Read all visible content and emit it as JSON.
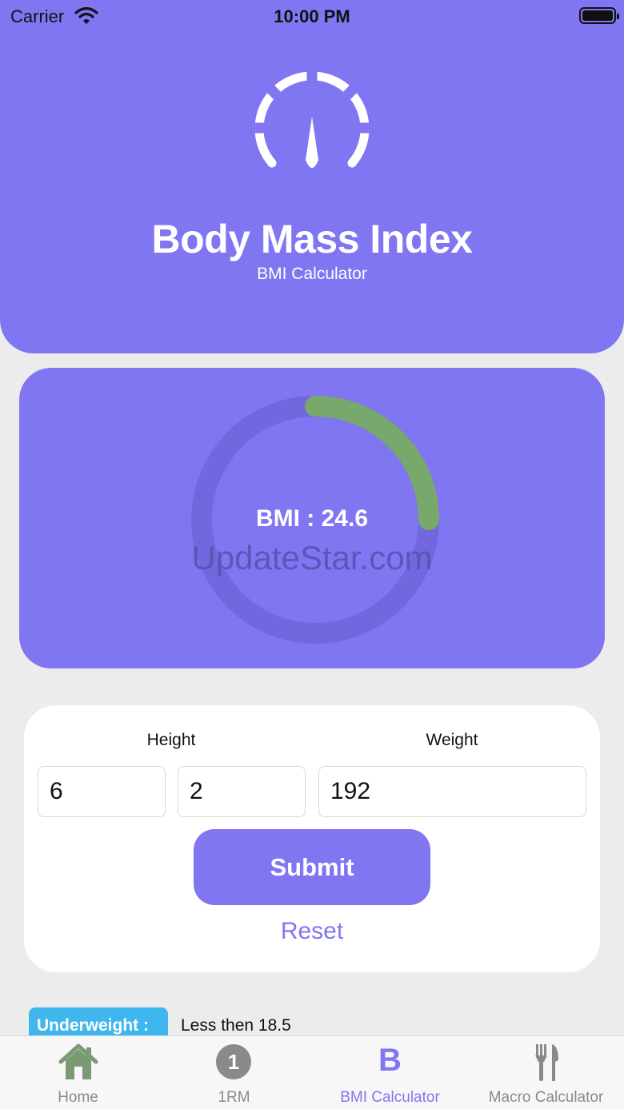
{
  "status_bar": {
    "carrier": "Carrier",
    "time": "10:00 PM",
    "icons": [
      "wifi-icon",
      "battery-icon"
    ]
  },
  "header": {
    "icon": "speedometer-icon",
    "title": "Body Mass Index",
    "subtitle": "BMI Calculator"
  },
  "result": {
    "label": "BMI : 24.6",
    "bmi": 24.6,
    "progress_fraction": 0.25,
    "watermark": "UpdateStar.com"
  },
  "form": {
    "height_label": "Height",
    "weight_label": "Weight",
    "height_feet": "6",
    "height_inches": "2",
    "weight": "192",
    "submit_label": "Submit",
    "reset_label": "Reset"
  },
  "legend": [
    {
      "badge": "Underweight :",
      "text": "Less then 18.5",
      "color": "#3fb7ee"
    }
  ],
  "tabs": [
    {
      "label": "Home",
      "icon": "home-icon",
      "active": false
    },
    {
      "label": "1RM",
      "icon": "one-circle-icon",
      "active": false
    },
    {
      "label": "BMI Calculator",
      "icon": "letter-b-icon",
      "glyph": "B",
      "active": true
    },
    {
      "label": "Macro Calculator",
      "icon": "fork-knife-icon",
      "active": false
    }
  ],
  "colors": {
    "accent": "#8176f2",
    "progress": "#77a86c",
    "ring_track": "#7267de",
    "background": "#ececec",
    "underweight": "#3fb7ee"
  }
}
